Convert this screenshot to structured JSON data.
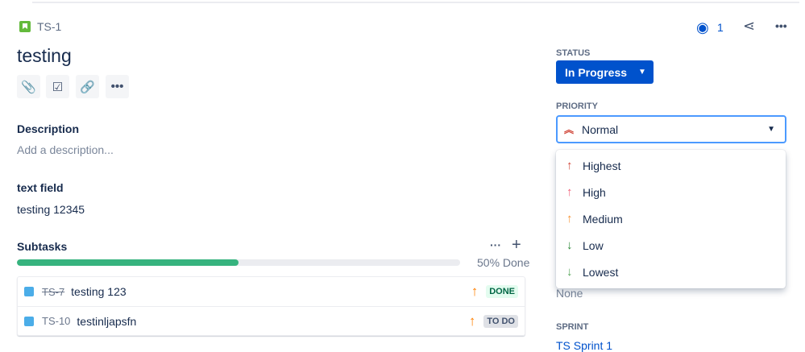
{
  "issue": {
    "key": "TS-1",
    "title": "testing"
  },
  "toolbar": {
    "attach": "attach-icon",
    "subtask": "subtask-icon",
    "link": "link-icon",
    "more": "more-icon"
  },
  "description": {
    "label": "Description",
    "placeholder": "Add a description..."
  },
  "text_field": {
    "label": "text field",
    "value": "testing 12345"
  },
  "subtasks": {
    "label": "Subtasks",
    "progress": 0.5,
    "progress_text": "50% Done",
    "items": [
      {
        "key": "TS-7",
        "summary": "testing 123",
        "status": "DONE",
        "done": true
      },
      {
        "key": "TS-10",
        "summary": "testinljapsfn",
        "status": "TO DO",
        "done": false
      }
    ]
  },
  "header": {
    "watch_count": "1"
  },
  "status": {
    "label": "STATUS",
    "value": "In Progress"
  },
  "priority": {
    "label": "PRIORITY",
    "value": "Normal",
    "options": [
      {
        "label": "Highest",
        "color": "#d04437",
        "dir": "up"
      },
      {
        "label": "High",
        "color": "#f15c75",
        "dir": "up"
      },
      {
        "label": "Medium",
        "color": "#f79232",
        "dir": "up"
      },
      {
        "label": "Low",
        "color": "#2a8735",
        "dir": "down"
      },
      {
        "label": "Lowest",
        "color": "#55a557",
        "dir": "down"
      }
    ]
  },
  "hidden_field": {
    "value": "None"
  },
  "sprint": {
    "label": "SPRINT",
    "value": "TS Sprint 1"
  }
}
